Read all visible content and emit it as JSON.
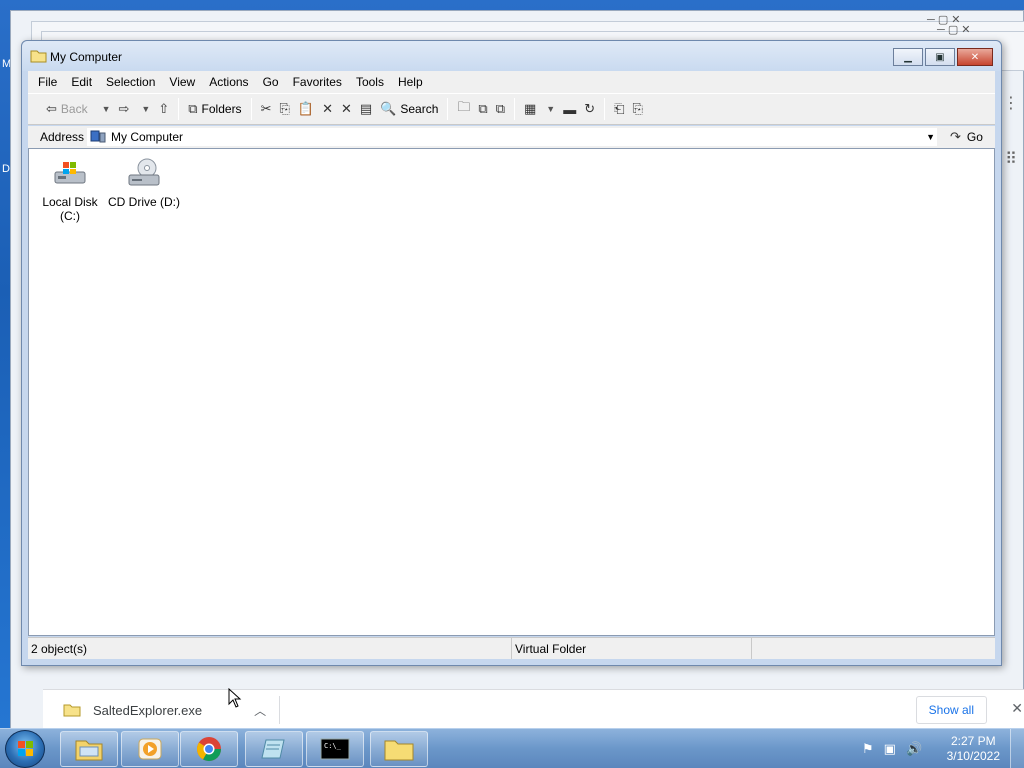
{
  "desktop": {
    "letters": [
      "M",
      "D"
    ]
  },
  "background_browser": {
    "download_file": "SaltedExplorer.exe",
    "show_all_label": "Show all"
  },
  "window": {
    "title": "My Computer",
    "menus": [
      "File",
      "Edit",
      "Selection",
      "View",
      "Actions",
      "Go",
      "Favorites",
      "Tools",
      "Help"
    ],
    "toolbar": {
      "back_label": "Back",
      "folders_label": "Folders",
      "search_label": "Search"
    },
    "address": {
      "label": "Address",
      "value": "My Computer",
      "go_label": "Go"
    },
    "items": [
      {
        "label": "Local Disk (C:)",
        "icon": "hard-drive-icon"
      },
      {
        "label": "CD Drive (D:)",
        "icon": "cd-drive-icon"
      }
    ],
    "status": {
      "count": "2 object(s)",
      "type": "Virtual Folder"
    }
  },
  "taskbar": {
    "apps": [
      "file-explorer-icon",
      "media-player-icon",
      "chrome-icon",
      "notepad-icon",
      "command-prompt-icon",
      "folder-icon"
    ],
    "clock_time": "2:27 PM",
    "clock_date": "3/10/2022"
  },
  "colors": {
    "accent": "#1a73e8",
    "taskbar": "#6b97c9",
    "window_frame": "#c6d7ee"
  }
}
